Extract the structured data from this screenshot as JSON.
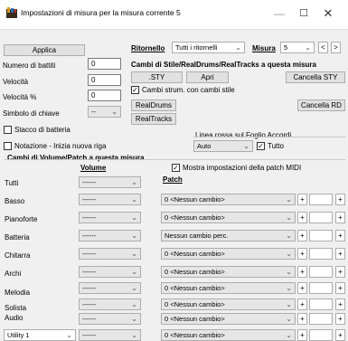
{
  "window": {
    "title": "Impostazioni di misura per la misura corrente 5",
    "minimize": "—",
    "maximize": "☐",
    "close": "✕"
  },
  "left": {
    "apply_label": "Applica",
    "fields": [
      {
        "label": "Numero di battiti",
        "value": "0"
      },
      {
        "label": "Velocità",
        "value": "0"
      },
      {
        "label": "Velocità %",
        "value": "0"
      }
    ],
    "key_label": "Simbolo di chiave",
    "key_value": "--",
    "stop_label": "Stacco di batteria",
    "notation_label": "Notazione - Inizia nuova riga"
  },
  "ritornello": {
    "label": "Ritornello",
    "value": "Tutti i ritornelli",
    "misura_label": "Misura",
    "misura_value": "5",
    "prev": "<",
    "next": ">"
  },
  "style_section": {
    "title": "Cambi di Stile/RealDrums/RealTracks a questa misura",
    "sty_label": ".STY",
    "open_label": "Apri",
    "cancel_sty_label": "Cancella STY",
    "change_instr_label": "Cambi strum. con cambi stile",
    "realdrums_label": "RealDrums",
    "cancel_rd_label": "Cancella RD",
    "realtracks_label": "RealTracks"
  },
  "red_line": {
    "title": "Linea rossa sul Foglio Accordi",
    "value": "Auto",
    "all_label": "Tutto"
  },
  "volume_section": {
    "title": "Cambi di Volume/Patch a questa misura",
    "volume_header": "Volume",
    "patch_header": "Patch",
    "show_midi_label": "Mostra impostazioni della patch MIDI",
    "rows": [
      {
        "label": "Tutti",
        "volume": "------",
        "patch": null
      },
      {
        "label": "Basso",
        "volume": "------",
        "patch": "0 <Nessun cambio>"
      },
      {
        "label": "Pianoforte",
        "volume": "------",
        "patch": "0 <Nessun cambio>"
      },
      {
        "label": "Batteria",
        "volume": "------",
        "patch": "Nessun cambio perc."
      },
      {
        "label": "Chitarra",
        "volume": "------",
        "patch": "0 <Nessun cambio>"
      },
      {
        "label": "Archi",
        "volume": "------",
        "patch": "0 <Nessun cambio>"
      },
      {
        "label": "Melodia",
        "volume": "------",
        "patch": "0 <Nessun cambio>"
      },
      {
        "label": "Solista",
        "volume": "------",
        "patch": "0 <Nessun cambio>"
      },
      {
        "label": "Audio",
        "volume": "------",
        "patch": "0 <Nessun cambio>"
      },
      {
        "label": "Utility 1",
        "volume": "------",
        "patch": "0 <Nessun cambio>"
      }
    ]
  }
}
